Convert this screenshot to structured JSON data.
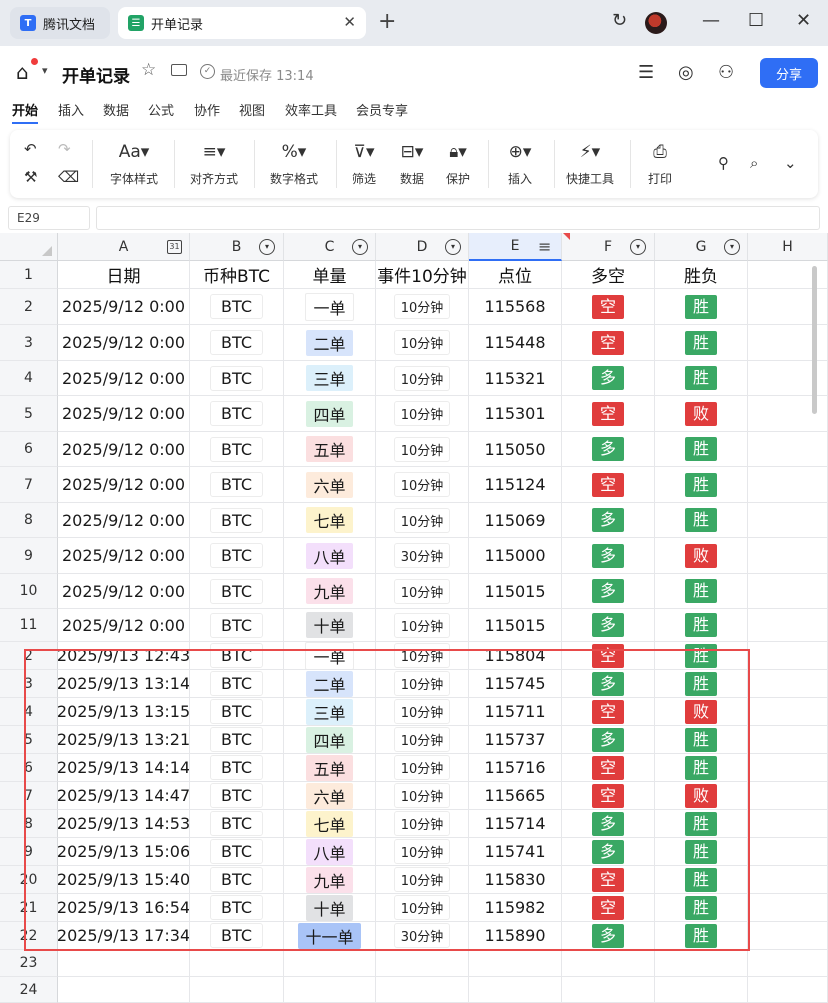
{
  "browser": {
    "tabs": [
      {
        "label": "腾讯文档",
        "icon": "tencent-docs-icon",
        "active": false
      },
      {
        "label": "开单记录",
        "icon": "sheet-icon",
        "active": true
      }
    ]
  },
  "header": {
    "title": "开单记录",
    "save_status": "最近保存 13:14",
    "share_label": "分享"
  },
  "ribbon_tabs": [
    "开始",
    "插入",
    "数据",
    "公式",
    "协作",
    "视图",
    "效率工具",
    "会员专享"
  ],
  "toolbar": {
    "font_style": "字体样式",
    "align": "对齐方式",
    "number_format": "数字格式",
    "filter": "筛选",
    "data": "数据",
    "protect": "保护",
    "insert": "插入",
    "quick_tools": "快捷工具",
    "print": "打印"
  },
  "formula_bar": {
    "cell_ref": "E29",
    "value": ""
  },
  "columns": [
    "A",
    "B",
    "C",
    "D",
    "E",
    "F",
    "G",
    "H"
  ],
  "table": {
    "headers": [
      "日期",
      "币种BTC",
      "单量",
      "事件10分钟",
      "点位",
      "多空",
      "胜负"
    ],
    "rows": [
      {
        "row": "1"
      },
      {
        "row": "2",
        "date": "2025/9/12 0:00",
        "coin": "BTC",
        "qty": "一单",
        "event": "10分钟",
        "price": "115568",
        "dir": "空",
        "result": "胜"
      },
      {
        "row": "3",
        "date": "2025/9/12 0:00",
        "coin": "BTC",
        "qty": "二单",
        "event": "10分钟",
        "price": "115448",
        "dir": "空",
        "result": "胜"
      },
      {
        "row": "4",
        "date": "2025/9/12 0:00",
        "coin": "BTC",
        "qty": "三单",
        "event": "10分钟",
        "price": "115321",
        "dir": "多",
        "result": "胜"
      },
      {
        "row": "5",
        "date": "2025/9/12 0:00",
        "coin": "BTC",
        "qty": "四单",
        "event": "10分钟",
        "price": "115301",
        "dir": "空",
        "result": "败"
      },
      {
        "row": "6",
        "date": "2025/9/12 0:00",
        "coin": "BTC",
        "qty": "五单",
        "event": "10分钟",
        "price": "115050",
        "dir": "多",
        "result": "胜"
      },
      {
        "row": "7",
        "date": "2025/9/12 0:00",
        "coin": "BTC",
        "qty": "六单",
        "event": "10分钟",
        "price": "115124",
        "dir": "空",
        "result": "胜"
      },
      {
        "row": "8",
        "date": "2025/9/12 0:00",
        "coin": "BTC",
        "qty": "七单",
        "event": "10分钟",
        "price": "115069",
        "dir": "多",
        "result": "胜"
      },
      {
        "row": "9",
        "date": "2025/9/12 0:00",
        "coin": "BTC",
        "qty": "八单",
        "event": "30分钟",
        "price": "115000",
        "dir": "多",
        "result": "败"
      },
      {
        "row": "10",
        "date": "2025/9/12 0:00",
        "coin": "BTC",
        "qty": "九单",
        "event": "10分钟",
        "price": "115015",
        "dir": "多",
        "result": "胜"
      },
      {
        "row": "11",
        "date": "2025/9/12 0:00",
        "coin": "BTC",
        "qty": "十单",
        "event": "10分钟",
        "price": "115015",
        "dir": "多",
        "result": "胜"
      },
      {
        "row": "2",
        "date": "2025/9/13 12:43",
        "coin": "BTC",
        "qty": "一单",
        "event": "10分钟",
        "price": "115804",
        "dir": "空",
        "result": "胜"
      },
      {
        "row": "3",
        "date": "2025/9/13 13:14",
        "coin": "BTC",
        "qty": "二单",
        "event": "10分钟",
        "price": "115745",
        "dir": "多",
        "result": "胜"
      },
      {
        "row": "4",
        "date": "2025/9/13 13:15",
        "coin": "BTC",
        "qty": "三单",
        "event": "10分钟",
        "price": "115711",
        "dir": "空",
        "result": "败"
      },
      {
        "row": "5",
        "date": "2025/9/13 13:21",
        "coin": "BTC",
        "qty": "四单",
        "event": "10分钟",
        "price": "115737",
        "dir": "多",
        "result": "胜"
      },
      {
        "row": "6",
        "date": "2025/9/13 14:14",
        "coin": "BTC",
        "qty": "五单",
        "event": "10分钟",
        "price": "115716",
        "dir": "空",
        "result": "胜"
      },
      {
        "row": "7",
        "date": "2025/9/13 14:47",
        "coin": "BTC",
        "qty": "六单",
        "event": "10分钟",
        "price": "115665",
        "dir": "空",
        "result": "败"
      },
      {
        "row": "8",
        "date": "2025/9/13 14:53",
        "coin": "BTC",
        "qty": "七单",
        "event": "10分钟",
        "price": "115714",
        "dir": "多",
        "result": "胜"
      },
      {
        "row": "9",
        "date": "2025/9/13 15:06",
        "coin": "BTC",
        "qty": "八单",
        "event": "10分钟",
        "price": "115741",
        "dir": "多",
        "result": "胜"
      },
      {
        "row": "20",
        "date": "2025/9/13 15:40",
        "coin": "BTC",
        "qty": "九单",
        "event": "10分钟",
        "price": "115830",
        "dir": "空",
        "result": "胜"
      },
      {
        "row": "21",
        "date": "2025/9/13 16:54",
        "coin": "BTC",
        "qty": "十单",
        "event": "10分钟",
        "price": "115982",
        "dir": "空",
        "result": "胜"
      },
      {
        "row": "22",
        "date": "2025/9/13 17:34",
        "coin": "BTC",
        "qty": "十一单",
        "event": "30分钟",
        "price": "115890",
        "dir": "多",
        "result": "胜"
      },
      {
        "row": "23"
      },
      {
        "row": "24"
      }
    ]
  },
  "colors": {
    "accent": "#2f6ef5",
    "short_red": "#e03c3c",
    "long_green": "#3aa864",
    "highlight_box": "#e84a4a",
    "qty_fills": {
      "一单": "#ffffff",
      "二单": "#d7e4fb",
      "三单": "#dcf0fb",
      "四单": "#d9f1e2",
      "五单": "#fbdfe0",
      "六单": "#fdebdc",
      "七单": "#fdf3cc",
      "八单": "#f3dffb",
      "九单": "#fbe0ea",
      "十单": "#e1e2e4",
      "十一单": "#a9c4f7"
    }
  }
}
